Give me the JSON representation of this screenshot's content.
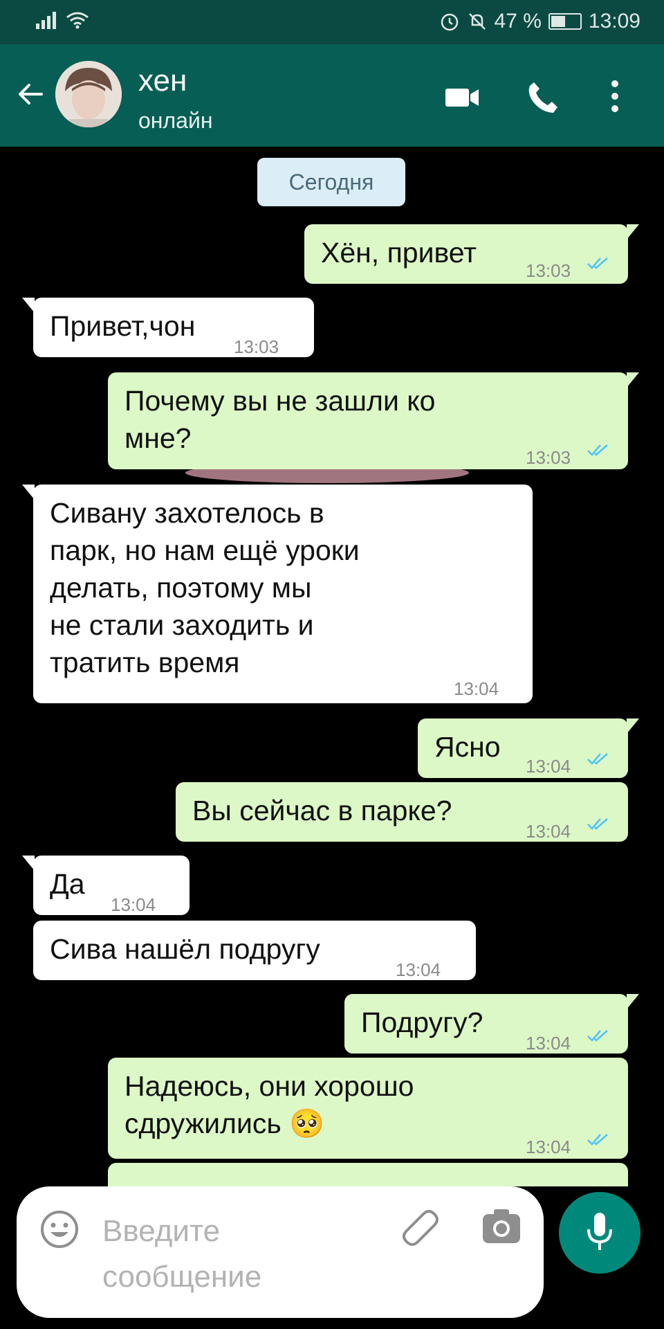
{
  "status_bar": {
    "battery": "47 %",
    "time": "13:09"
  },
  "header": {
    "contact_name": "хен",
    "status": "онлайн"
  },
  "date_separator": "Сегодня",
  "messages": [
    {
      "direction": "out",
      "lines": [
        "Хён, привет"
      ],
      "time": "13:03",
      "read": true
    },
    {
      "direction": "in",
      "lines": [
        "Привет,чон"
      ],
      "time": "13:03"
    },
    {
      "direction": "out",
      "lines": [
        "Почему вы не зашли ко",
        "мне?"
      ],
      "time": "13:03",
      "read": true
    },
    {
      "direction": "in",
      "lines": [
        "Сивану захотелось в",
        "парк, но нам ещё уроки",
        "делать, поэтому мы",
        "не стали заходить и",
        "тратить время"
      ],
      "time": "13:04"
    },
    {
      "direction": "out",
      "lines": [
        "Ясно"
      ],
      "time": "13:04",
      "read": true
    },
    {
      "direction": "out",
      "lines": [
        "Вы сейчас в парке?"
      ],
      "time": "13:04",
      "read": true
    },
    {
      "direction": "in",
      "lines": [
        "Да"
      ],
      "time": "13:04"
    },
    {
      "direction": "in",
      "lines": [
        "Сива нашёл подругу"
      ],
      "time": "13:04"
    },
    {
      "direction": "out",
      "lines": [
        "Подругу?"
      ],
      "time": "13:04",
      "read": true
    },
    {
      "direction": "out",
      "lines": [
        "Надеюсь, они хорошо",
        "сдружились"
      ],
      "emoji": "🥺",
      "time": "13:04",
      "read": true
    }
  ],
  "composer": {
    "placeholder_lines": [
      "Введите",
      "сообщение"
    ]
  },
  "colors": {
    "header": "#075e54",
    "status_bar": "#0b4a43",
    "outgoing_bubble": "#dcf8c6",
    "incoming_bubble": "#ffffff",
    "read_ticks": "#4fc3f7",
    "mic_button": "#00897b",
    "background": "#000000"
  },
  "icons": [
    "signal-icon",
    "wifi-icon",
    "alarm-icon",
    "mute-icon",
    "battery-icon",
    "back-arrow-icon",
    "video-call-icon",
    "phone-icon",
    "more-vert-icon",
    "emoji-icon",
    "attach-icon",
    "camera-icon",
    "mic-icon"
  ]
}
